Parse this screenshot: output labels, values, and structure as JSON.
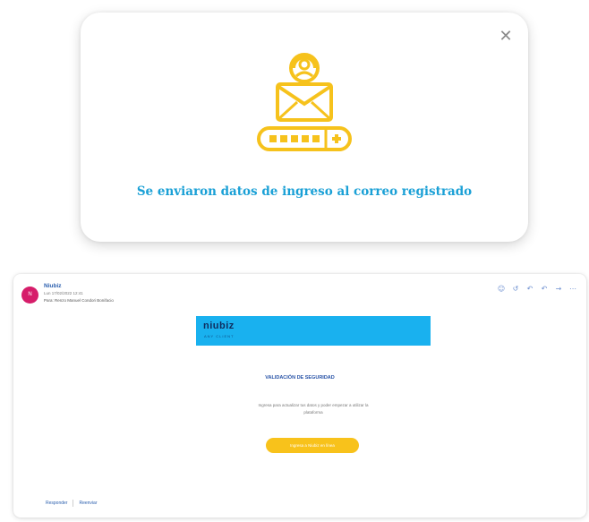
{
  "modal": {
    "close_glyph": "✕",
    "icon": "email-lock-password-icon",
    "message": "Se enviaron datos de ingreso al correo registrado",
    "accent_color": "#f6c21c",
    "text_color": "#1aa0d6"
  },
  "email": {
    "avatar_initials": "N",
    "sender": "Niubiz",
    "date": "Lun 17/02/2022 12:41",
    "to_label": "Para:",
    "to_name": "Renzo Manuel Condori Bonifacio",
    "actions": [
      "smile-icon",
      "undo-icon",
      "reply-icon",
      "reply-all-icon",
      "forward-icon",
      "more-icon"
    ],
    "banner": {
      "logo": "niubiz",
      "tagline": "ANY CLIENT",
      "color": "#19b1ef"
    },
    "security_title": "VALIDACIÓN DE SEGURIDAD",
    "security_text": "Ingresa para actualizar tus datos y poder empezar a utilizar la plataforma",
    "cta_label": "Ingresa a Niubiz en línea",
    "cta_color": "#f8c21b",
    "reply_label": "Responder",
    "forward_label": "Reenviar"
  }
}
